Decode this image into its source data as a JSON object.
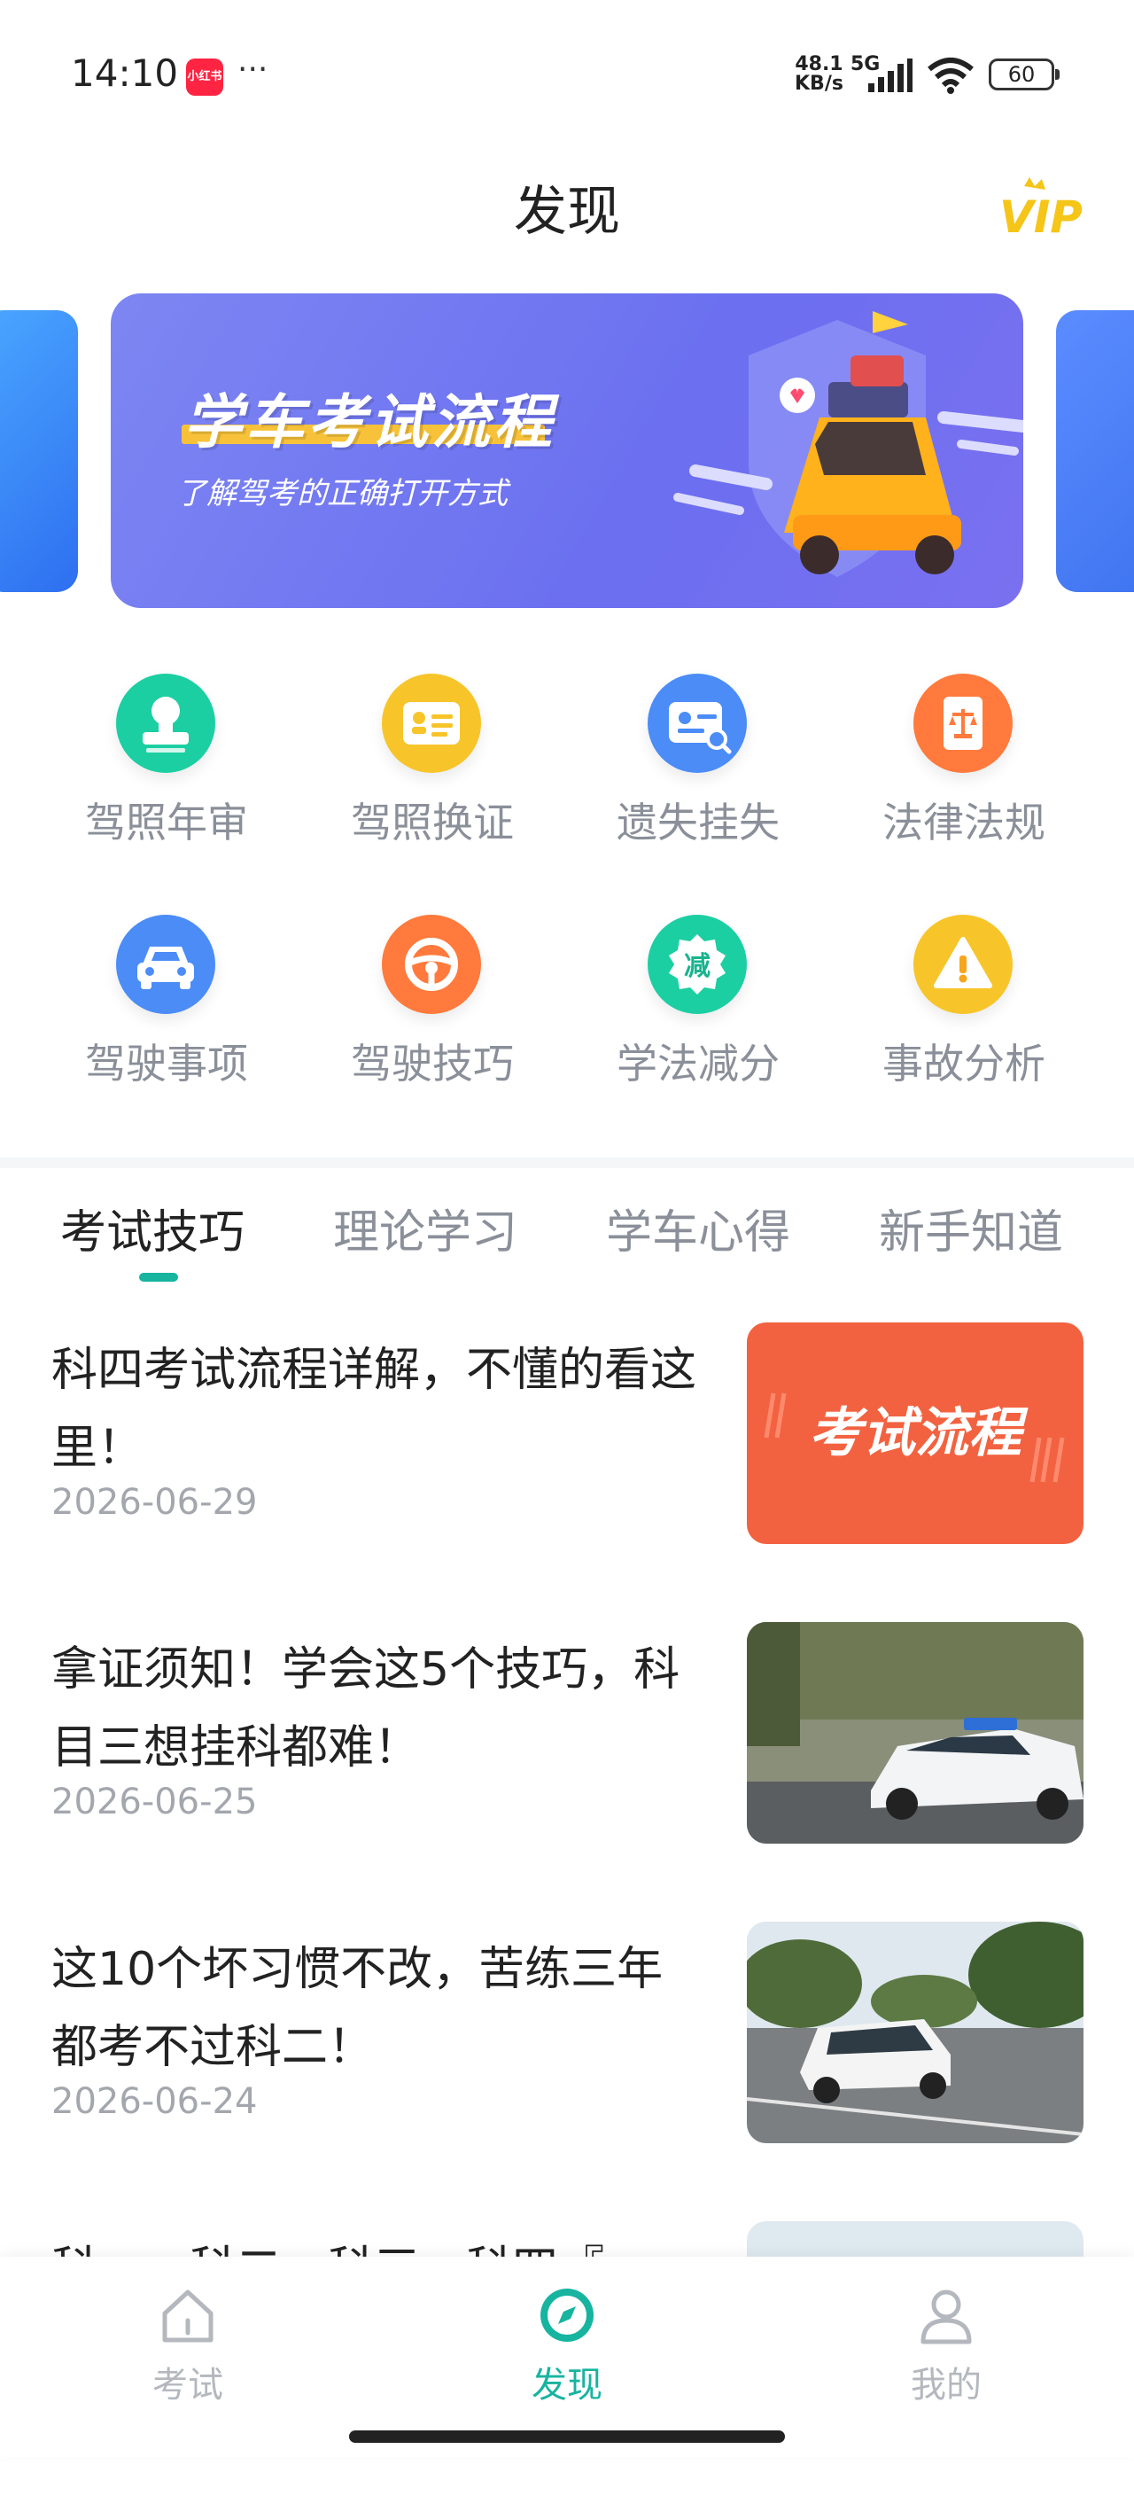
{
  "status_bar": {
    "time": "14:10",
    "app_badge": "小红书",
    "more": "···",
    "net_speed_value": "48.1",
    "net_speed_unit": "KB/s",
    "network": "5G",
    "battery": "60",
    "icons": [
      "signal-icon",
      "wifi-icon",
      "battery-icon"
    ]
  },
  "header": {
    "title": "发现",
    "vip_label": "VIP"
  },
  "banner": {
    "title": "学车考试流程",
    "subtitle": "了解驾考的正确打开方式"
  },
  "grid": [
    {
      "label": "驾照年审",
      "icon": "stamp-icon",
      "color": "#1ccfa2"
    },
    {
      "label": "驾照换证",
      "icon": "id-card-icon",
      "color": "#f7c52a"
    },
    {
      "label": "遗失挂失",
      "icon": "search-card-icon",
      "color": "#4b8cf7"
    },
    {
      "label": "法律法规",
      "icon": "law-book-icon",
      "color": "#ff7a3c"
    },
    {
      "label": "驾驶事项",
      "icon": "car-icon",
      "color": "#4b8cf7"
    },
    {
      "label": "驾驶技巧",
      "icon": "steering-wheel-icon",
      "color": "#ff7a3c"
    },
    {
      "label": "学法减分",
      "icon": "minus-badge-icon",
      "color": "#1ccfa2",
      "badge_text": "减"
    },
    {
      "label": "事故分析",
      "icon": "warning-icon",
      "color": "#f7c52a"
    }
  ],
  "tabs": [
    "考试技巧",
    "理论学习",
    "学车心得",
    "新手知道"
  ],
  "active_tab": 0,
  "articles": [
    {
      "title": "科四考试流程详解，不懂的看这里！",
      "date": "2026-06-29",
      "image_text": "考试流程"
    },
    {
      "title": "拿证须知！学会这5个技巧，科目三想挂科都难！",
      "date": "2026-06-25"
    },
    {
      "title": "这10个坏习惯不改，苦练三年都考不过科二！",
      "date": "2026-06-24"
    },
    {
      "title": "科一、科二、科三、科四『",
      "date": ""
    }
  ],
  "bottom_nav": [
    {
      "label": "考试",
      "icon": "home-icon"
    },
    {
      "label": "发现",
      "icon": "compass-icon"
    },
    {
      "label": "我的",
      "icon": "user-icon"
    }
  ],
  "active_nav": 1,
  "colors": {
    "accent": "#17b4a0",
    "banner": "#6f74f0",
    "text": "#222222",
    "muted": "#8a8f99"
  }
}
